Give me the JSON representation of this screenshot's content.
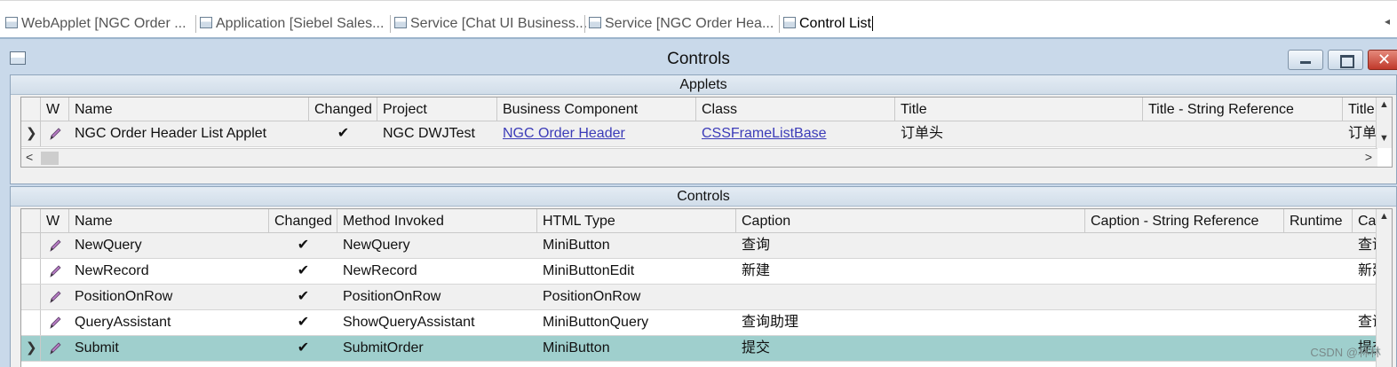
{
  "tabs": [
    {
      "label": "WebApplet [NGC Order ..."
    },
    {
      "label": "Application [Siebel Sales..."
    },
    {
      "label": "Service [Chat UI Business..."
    },
    {
      "label": "Service [NGC Order Hea..."
    },
    {
      "label": "Control List"
    }
  ],
  "tab_scroll_glyph": "◂",
  "window": {
    "title": "Controls",
    "close_glyph": "✕"
  },
  "applets": {
    "section_title": "Applets",
    "columns": [
      "W",
      "Name",
      "Changed",
      "Project",
      "Business Component",
      "Class",
      "Title",
      "Title - String Reference",
      "Title"
    ],
    "rows": [
      {
        "name": "NGC Order Header List Applet",
        "changed": "✔",
        "project": "NGC DWJTest",
        "business_component": "NGC Order Header",
        "class": "CSSFrameListBase",
        "title": "订单头",
        "title_string_ref": "",
        "title2": "订单头"
      }
    ]
  },
  "controls": {
    "section_title": "Controls",
    "columns": [
      "W",
      "Name",
      "Changed",
      "Method Invoked",
      "HTML Type",
      "Caption",
      "Caption - String Reference",
      "Runtime",
      "Caption"
    ],
    "rows": [
      {
        "name": "NewQuery",
        "changed": "✔",
        "method": "NewQuery",
        "html_type": "MiniButton",
        "caption": "查询",
        "caption2": "查询"
      },
      {
        "name": "NewRecord",
        "changed": "✔",
        "method": "NewRecord",
        "html_type": "MiniButtonEdit",
        "caption": "新建",
        "caption2": "新建"
      },
      {
        "name": "PositionOnRow",
        "changed": "✔",
        "method": "PositionOnRow",
        "html_type": "PositionOnRow",
        "caption": "",
        "caption2": ""
      },
      {
        "name": "QueryAssistant",
        "changed": "✔",
        "method": "ShowQueryAssistant",
        "html_type": "MiniButtonQuery",
        "caption": "查询助理",
        "caption2": "查询"
      },
      {
        "name": "Submit",
        "changed": "✔",
        "method": "SubmitOrder",
        "html_type": "MiniButton",
        "caption": "提交",
        "caption2": "提交"
      }
    ],
    "selected_index": 4
  },
  "selection_glyph": "❯",
  "scroll_glyphs": {
    "up": "▲",
    "down": "▼",
    "left": "<",
    "right": ">"
  },
  "watermark": "CSDN @林林"
}
